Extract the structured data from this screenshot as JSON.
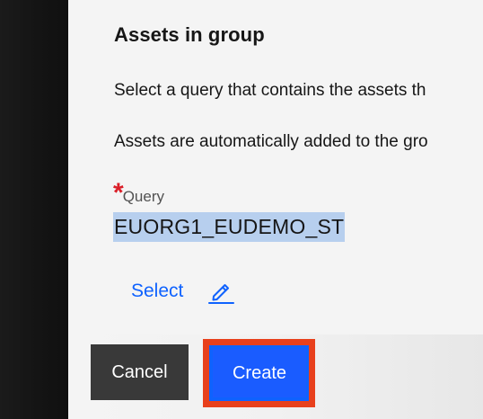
{
  "section": {
    "title": "Assets in group",
    "description_1": "Select a query that contains the assets th",
    "description_2": "Assets are automatically added to the gro"
  },
  "query_field": {
    "required_mark": "*",
    "label": "Query",
    "value": "EUORG1_EUDEMO_ST",
    "value_highlight_color": "#b7cfee"
  },
  "select_action": {
    "label": "Select",
    "icon": "pencil-edit-icon",
    "color": "#0f62fe"
  },
  "footer": {
    "cancel_label": "Cancel",
    "create_label": "Create",
    "create_color": "#0f62fe",
    "highlight_border_color": "#e8401c"
  }
}
